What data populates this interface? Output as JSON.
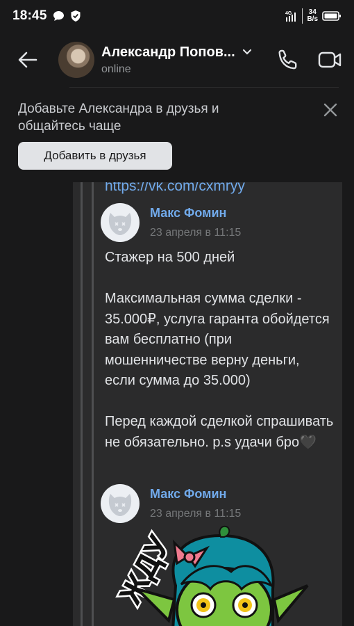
{
  "status_bar": {
    "time": "18:45",
    "net_speed_value": "34",
    "net_speed_unit": "B/s",
    "signal_label": "4G"
  },
  "header": {
    "contact_name": "Александр Попов...",
    "contact_status": "online"
  },
  "friend_banner": {
    "text": "Добавьте Александра в друзья и общайтесь чаще",
    "button_label": "Добавить в друзья"
  },
  "forwarded": {
    "link": "https://vk.com/cxmryy",
    "messages": [
      {
        "author": "Макс Фомин",
        "date": "23 апреля в 11:15",
        "text": "Стажер на 500 дней\n\nМаксимальная сумма сделки - 35.000₽, услуга гаранта обойдется вам бесплатно (при мошенничестве верну деньги, если сумма до 35.000)\n\nПеред каждой сделкой спрашивать не обязательно. p.s удачи бро🖤"
      },
      {
        "author": "Макс Фомин",
        "date": "23 апреля в 11:15",
        "sticker_text": "ЖДУ"
      }
    ]
  },
  "colors": {
    "background": "#19191a",
    "accent_link": "#71aaeb",
    "panel": "#2b2b2c"
  }
}
